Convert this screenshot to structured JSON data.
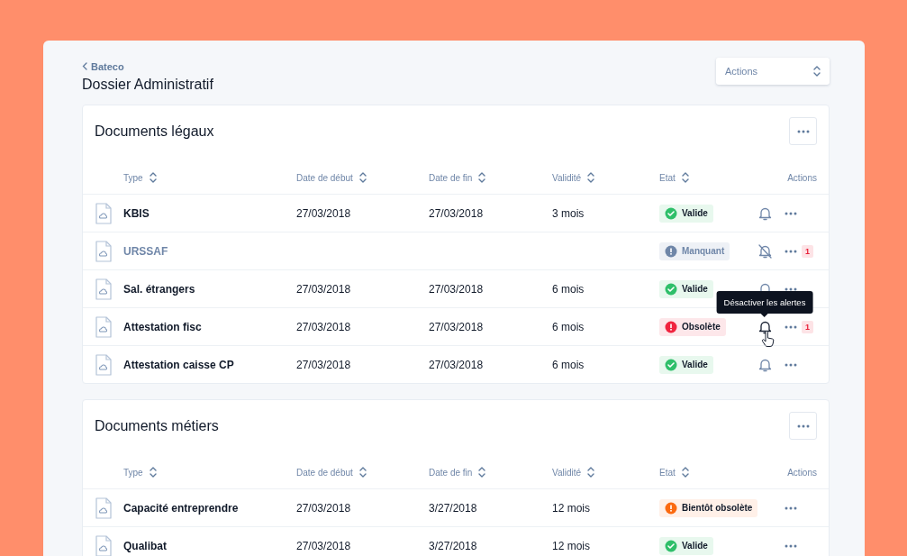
{
  "breadcrumb": {
    "label": "Bateco"
  },
  "title": "Dossier Administratif",
  "actions_select": {
    "placeholder": "Actions"
  },
  "sections": [
    {
      "title": "Documents légaux",
      "columns": [
        {
          "label": "Type",
          "sortable": true
        },
        {
          "label": "Date de début",
          "sortable": true
        },
        {
          "label": "Date de fin",
          "sortable": true
        },
        {
          "label": "Validité",
          "sortable": true
        },
        {
          "label": "Etat",
          "sortable": true
        },
        {
          "label": "Actions",
          "sortable": false
        }
      ],
      "rows": [
        {
          "type": "KBIS",
          "missing": false,
          "start": "27/03/2018",
          "end": "27/03/2018",
          "validity": "3 mois",
          "status": {
            "kind": "valid",
            "label": "Valide"
          },
          "alerts_on": true,
          "hovered": false
        },
        {
          "type": "URSSAF",
          "missing": true,
          "status": {
            "kind": "missing",
            "label": "Manquant"
          },
          "alerts_on": false,
          "hovered": false,
          "badge": "1"
        },
        {
          "type": "Sal. étrangers",
          "missing": false,
          "start": "27/03/2018",
          "end": "27/03/2018",
          "validity": "6 mois",
          "status": {
            "kind": "valid",
            "label": "Valide"
          },
          "alerts_on": true,
          "hovered": false
        },
        {
          "type": "Attestation fisc",
          "missing": false,
          "start": "27/03/2018",
          "end": "27/03/2018",
          "validity": "6 mois",
          "status": {
            "kind": "obsolete",
            "label": "Obsolète"
          },
          "alerts_on": true,
          "hovered": true,
          "tooltip": "Désactiver les alertes",
          "badge": "1"
        },
        {
          "type": "Attestation caisse CP",
          "missing": false,
          "start": "27/03/2018",
          "end": "27/03/2018",
          "validity": "6 mois",
          "status": {
            "kind": "valid",
            "label": "Valide"
          },
          "alerts_on": true,
          "hovered": false
        }
      ]
    },
    {
      "title": "Documents métiers",
      "columns": [
        {
          "label": "Type",
          "sortable": true
        },
        {
          "label": "Date de début",
          "sortable": true
        },
        {
          "label": "Date de fin",
          "sortable": true
        },
        {
          "label": "Validité",
          "sortable": true
        },
        {
          "label": "Etat",
          "sortable": true
        },
        {
          "label": "Actions",
          "sortable": false
        }
      ],
      "rows": [
        {
          "type": "Capacité entreprendre",
          "missing": false,
          "start": "27/03/2018",
          "end": "3/27/2018",
          "validity": "12 mois",
          "status": {
            "kind": "soon",
            "label": "Bientôt obsolète"
          }
        },
        {
          "type": "Qualibat",
          "missing": false,
          "start": "27/03/2018",
          "end": "3/27/2018",
          "validity": "12 mois",
          "status": {
            "kind": "valid",
            "label": "Valide"
          }
        }
      ]
    }
  ]
}
